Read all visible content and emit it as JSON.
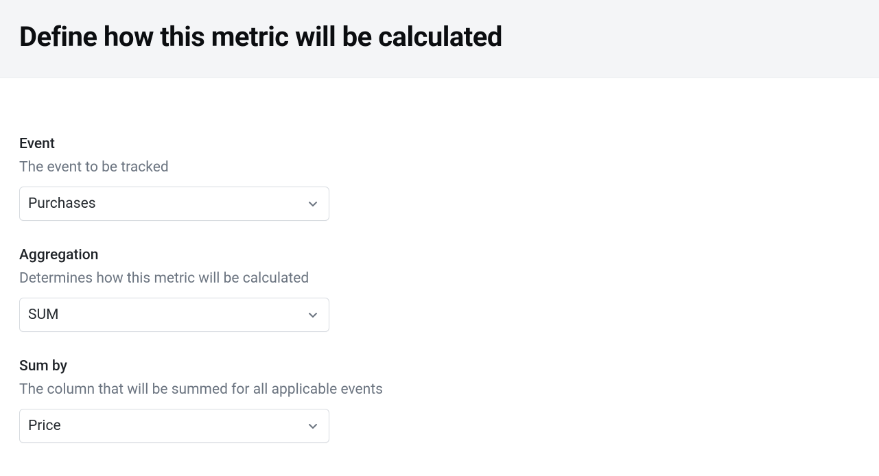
{
  "header": {
    "title": "Define how this metric will be calculated"
  },
  "fields": {
    "event": {
      "label": "Event",
      "description": "The event to be tracked",
      "value": "Purchases"
    },
    "aggregation": {
      "label": "Aggregation",
      "description": "Determines how this metric will be calculated",
      "value": "SUM"
    },
    "sumby": {
      "label": "Sum by",
      "description": "The column that will be summed for all applicable events",
      "value": "Price"
    }
  }
}
